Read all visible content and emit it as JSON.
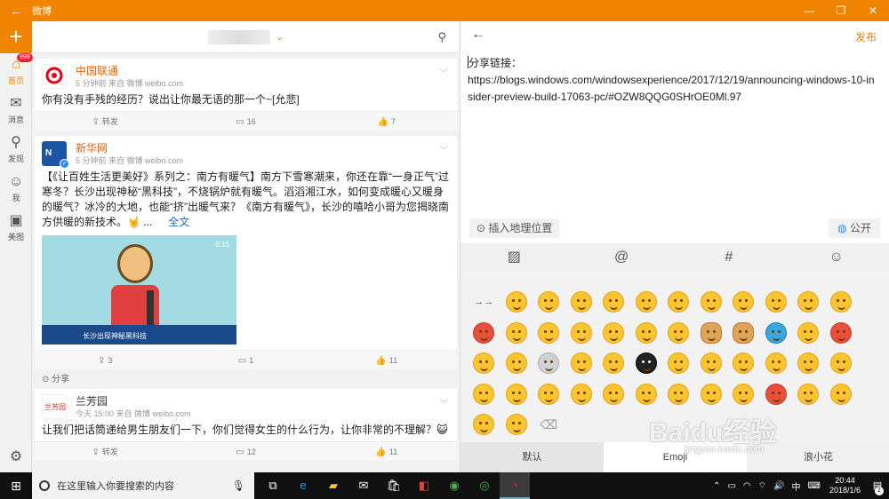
{
  "app": {
    "title": "微博"
  },
  "rail": {
    "badge": "999",
    "items": [
      {
        "label": "首页",
        "icon": "home-icon"
      },
      {
        "label": "消息",
        "icon": "mail-icon"
      },
      {
        "label": "发现",
        "icon": "search-icon"
      },
      {
        "label": "我",
        "icon": "person-icon"
      },
      {
        "label": "美图",
        "icon": "image-icon"
      }
    ]
  },
  "posts": [
    {
      "name": "中国联通",
      "time": "5 分钟前 来自 微博 weibo.com",
      "text": "你有没有手残的经历？说出让你最无语的那一个~[允悲]",
      "repost": "转发",
      "comments": "16",
      "likes": "7"
    },
    {
      "name": "新华网",
      "time": "5 分钟前 来自 微博 weibo.com",
      "text": "【《让百姓生活更美好》系列之：南方有暖气】南方下雪寒潮来，你还在靠“一身正气”过寒冬？长沙出现神秘“黑科技”，不烧锅炉就有暖气。滔滔湘江水，如何变成暖心又暖身的暖气？冰冷的大地，也能“挤”出暖气来？《南方有暖气》，长沙的嘻哈小哥为您揭晓南方供暖的新技术。🤘 ...",
      "more": "全文",
      "video_time": "0:15",
      "video_caption": "长沙出现神秘黑科技",
      "reposts": "3",
      "comments": "1",
      "likes": "11"
    },
    {
      "share_label": "分享",
      "name": "兰芳园",
      "time": "今天 15:00 来自 微博 weibo.com",
      "text": "让我们把话筒递给男生朋友们一下，你们觉得女生的什么行为，让你非常的不理解？😺",
      "repost": "转发",
      "comments": "12",
      "likes": "11"
    }
  ],
  "compose": {
    "publish": "发布",
    "share_label": "分享链接：",
    "url": "https://blogs.windows.com/windowsexperience/2017/12/19/announcing-windows-10-insider-preview-build-17063-pc/#OZW8QQG0SHrOE0Ml.97",
    "location": "插入地理位置",
    "visibility": "公开",
    "tabs": [
      "默认",
      "Emoji",
      "浪小花"
    ]
  },
  "taskbar": {
    "search_placeholder": "在这里输入你要搜索的内容",
    "ime": "中",
    "time": "20:44",
    "date": "2018/1/6",
    "notifications": "2"
  },
  "watermark": {
    "brand": "Baidu经验",
    "url": "jingyan.baidu.com"
  }
}
